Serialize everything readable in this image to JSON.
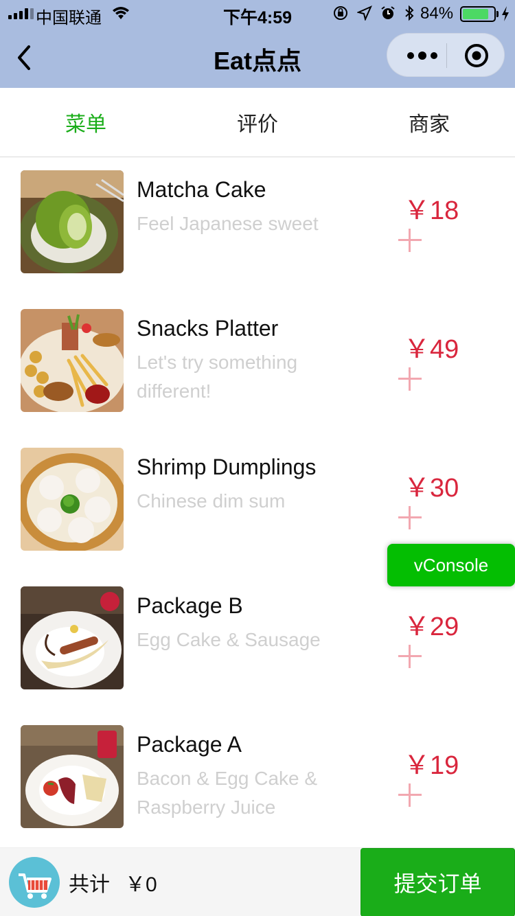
{
  "status_bar": {
    "carrier": "中国联通",
    "time": "下午4:59",
    "battery_percent": "84%",
    "battery_level": 0.84
  },
  "nav": {
    "title": "Eat点点"
  },
  "tabs": [
    {
      "label": "菜单",
      "active": true
    },
    {
      "label": "评价",
      "active": false
    },
    {
      "label": "商家",
      "active": false
    }
  ],
  "menu": [
    {
      "name": "Matcha Cake",
      "desc": "Feel Japanese sweet",
      "price": "￥18",
      "image": "matcha-cake-photo"
    },
    {
      "name": "Snacks Platter",
      "desc": "Let's try something different!",
      "price": "￥49",
      "image": "snacks-platter-photo"
    },
    {
      "name": "Shrimp Dumplings",
      "desc": "Chinese dim sum",
      "price": "￥30",
      "image": "shrimp-dumplings-photo"
    },
    {
      "name": "Package B",
      "desc": "Egg Cake & Sausage",
      "price": "￥29",
      "image": "package-b-photo"
    },
    {
      "name": "Package A",
      "desc": "Bacon & Egg Cake & Raspberry Juice",
      "price": "￥19",
      "image": "package-a-photo"
    }
  ],
  "vconsole": {
    "label": "vConsole"
  },
  "bottom": {
    "total_label": "共计",
    "total_value": "￥0",
    "submit_label": "提交订单"
  },
  "colors": {
    "accent": "#1aad19",
    "price": "#d9263d",
    "nav_bg": "#a9bcdf"
  }
}
